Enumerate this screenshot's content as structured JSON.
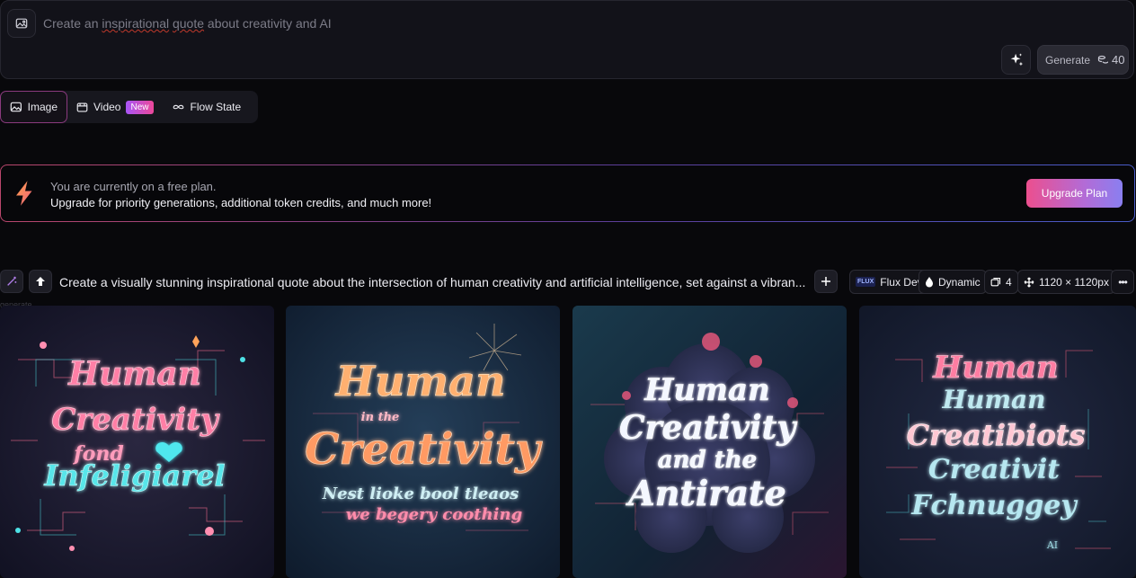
{
  "prompt": {
    "text_before": "Create an ",
    "text_misspelled": "inspirational",
    "text_middle": " ",
    "text_misspelled2": "quote",
    "text_after": " about creativity and AI"
  },
  "generate": {
    "label": "Generate",
    "cost": "40"
  },
  "modes": [
    {
      "label": "Image",
      "active": true
    },
    {
      "label": "Video",
      "badge": "New"
    },
    {
      "label": "Flow State"
    }
  ],
  "banner": {
    "line1": "You are currently on a free plan.",
    "line2": "Upgrade for priority generations, additional token credits, and much more!",
    "button": "Upgrade Plan"
  },
  "generation": {
    "label": "generate",
    "prompt": "Create a visually stunning inspirational quote about the intersection of human creativity and artificial intelligence, set against a vibran...",
    "model": "Flux Dev",
    "model_logo": "FLUX",
    "style": "Dynamic",
    "count": "4",
    "size": "1120 × 1120px",
    "more": "•••"
  },
  "images": [
    {
      "lines": [
        "Human",
        "Creativity",
        "fond",
        "Infeligiarel"
      ]
    },
    {
      "lines": [
        "Human",
        "in the",
        "Creativity",
        "Nest lioke bool tleaos",
        "we begery coothing"
      ]
    },
    {
      "lines": [
        "Human",
        "Creativity",
        "and the",
        "Antirate"
      ]
    },
    {
      "lines": [
        "Human",
        "Human",
        "Creatibiots",
        "Creativit",
        "Fchnuggey",
        "AI"
      ]
    }
  ],
  "colors": {
    "accent_pink": "#ec4f8e",
    "accent_purple": "#a855f7",
    "background": "#08080b",
    "panel": "#121219"
  }
}
